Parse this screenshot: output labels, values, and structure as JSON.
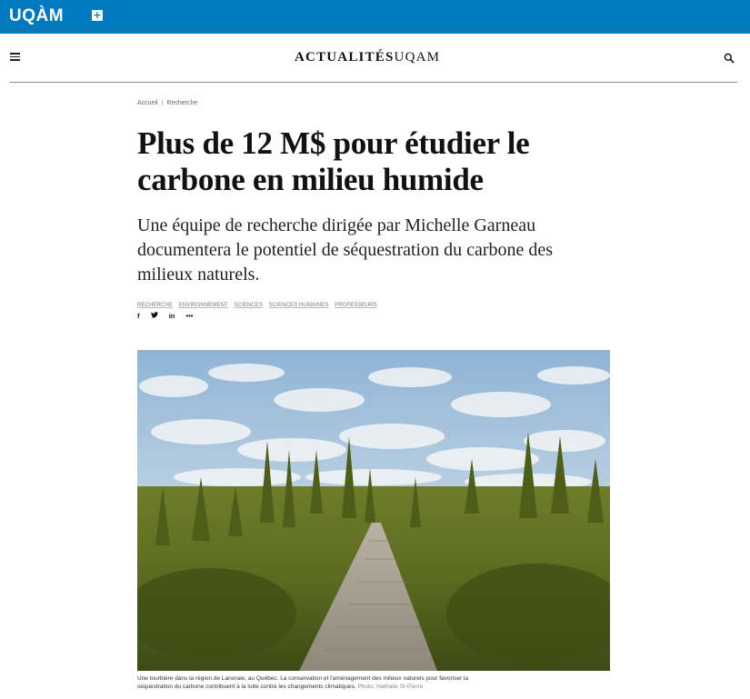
{
  "topbar": {
    "logo": "UQÀM",
    "plus_label": "+"
  },
  "header": {
    "site_title_bold": "ACTUALITÉS",
    "site_title_light": "UQAM",
    "icons": [
      "menu-icon",
      "search-icon"
    ]
  },
  "breadcrumb": {
    "home": "Accueil",
    "separator": "|",
    "section": "Recherche"
  },
  "article": {
    "title": "Plus de 12 M$ pour étudier le carbone en milieu humide",
    "lead": "Une équipe de recherche dirigée par Michelle Garneau documentera le potentiel de séquestration du carbone des milieux naturels.",
    "tags": [
      "RECHERCHE",
      "ENVIRONNEMENT",
      "SCIENCES",
      "SCIENCES HUMAINES",
      "PROFESSEURS"
    ],
    "share": {
      "facebook": "f",
      "twitter": "🐦",
      "linkedin": "in",
      "more": "•••"
    },
    "photo_caption": "Une tourbière dans la région de Lanoraie, au Québec. La conservation et l'aménagement des milieux naturels pour favoriser la séquestration du carbone contribuent à la lutte contre les changements climatiques.",
    "photo_credit": "Photo: Nathalie St-Pierre"
  },
  "colors": {
    "brand_blue": "#0079c1",
    "title_text": "#111111"
  }
}
